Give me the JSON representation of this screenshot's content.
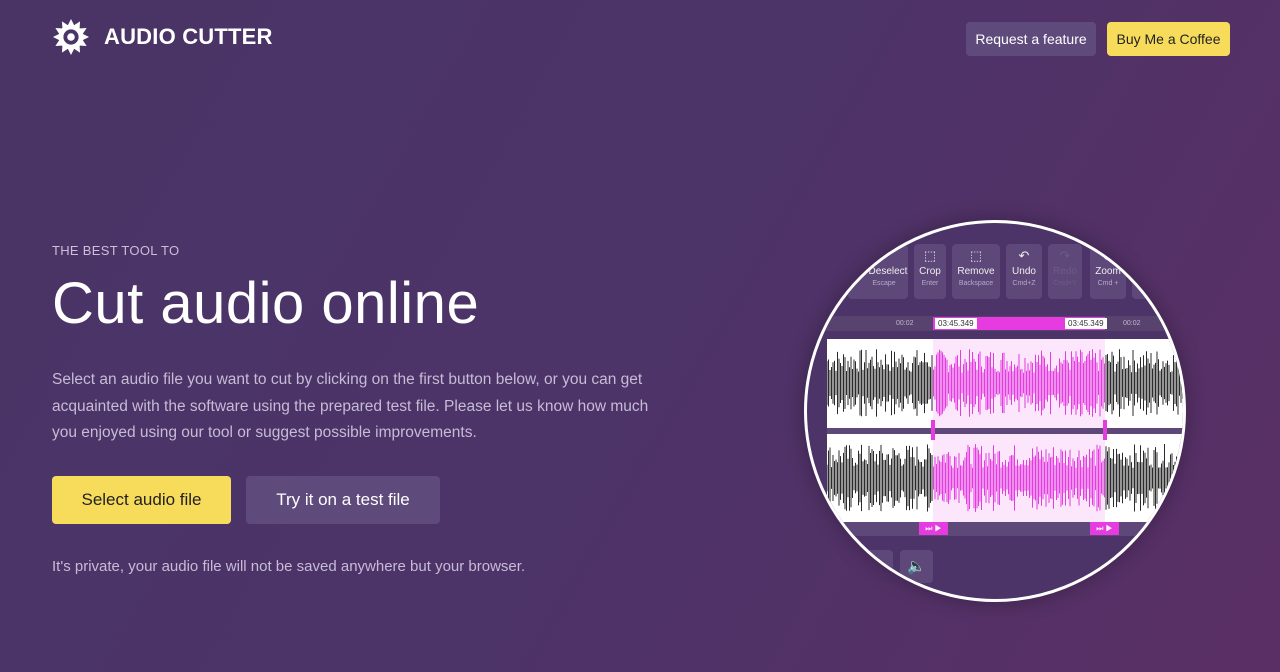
{
  "header": {
    "brand": "AUDIO CUTTER",
    "request_feature": "Request a feature",
    "buy_coffee": "Buy Me a Coffee"
  },
  "hero": {
    "eyebrow": "THE BEST TOOL TO",
    "title": "Cut audio online",
    "description": "Select an audio file you want to cut by clicking on the first button below, or you can get acquainted with the software using the prepared test file. Please let us know how much you enjoyed using our tool or suggest possible improvements.",
    "select_button": "Select audio file",
    "test_button": "Try it on a test file",
    "privacy": "It's private, your audio file will not be saved anywhere but your browser."
  },
  "preview": {
    "toolbar": [
      {
        "label": "Deselect",
        "shortcut": "Escape",
        "icon": "deselect-icon"
      },
      {
        "label": "Crop",
        "shortcut": "Enter",
        "icon": "crop-icon"
      },
      {
        "label": "Remove",
        "shortcut": "Backspace",
        "icon": "remove-icon"
      },
      {
        "label": "Undo",
        "shortcut": "Cmd+Z",
        "icon": "undo-icon"
      },
      {
        "label": "Redo",
        "shortcut": "Cmd+Y",
        "icon": "redo-icon",
        "disabled": true
      },
      {
        "label": "Zoom",
        "shortcut": "Cmd +",
        "icon": "zoom-icon"
      }
    ],
    "ruler_ticks": [
      "00:02",
      "00:02"
    ],
    "selection_start": "03:45.349",
    "selection_end": "03:45.349",
    "colors": {
      "accent": "#e53be0",
      "yellow": "#f7dc5b",
      "waveform": "#2b2b2b"
    }
  }
}
